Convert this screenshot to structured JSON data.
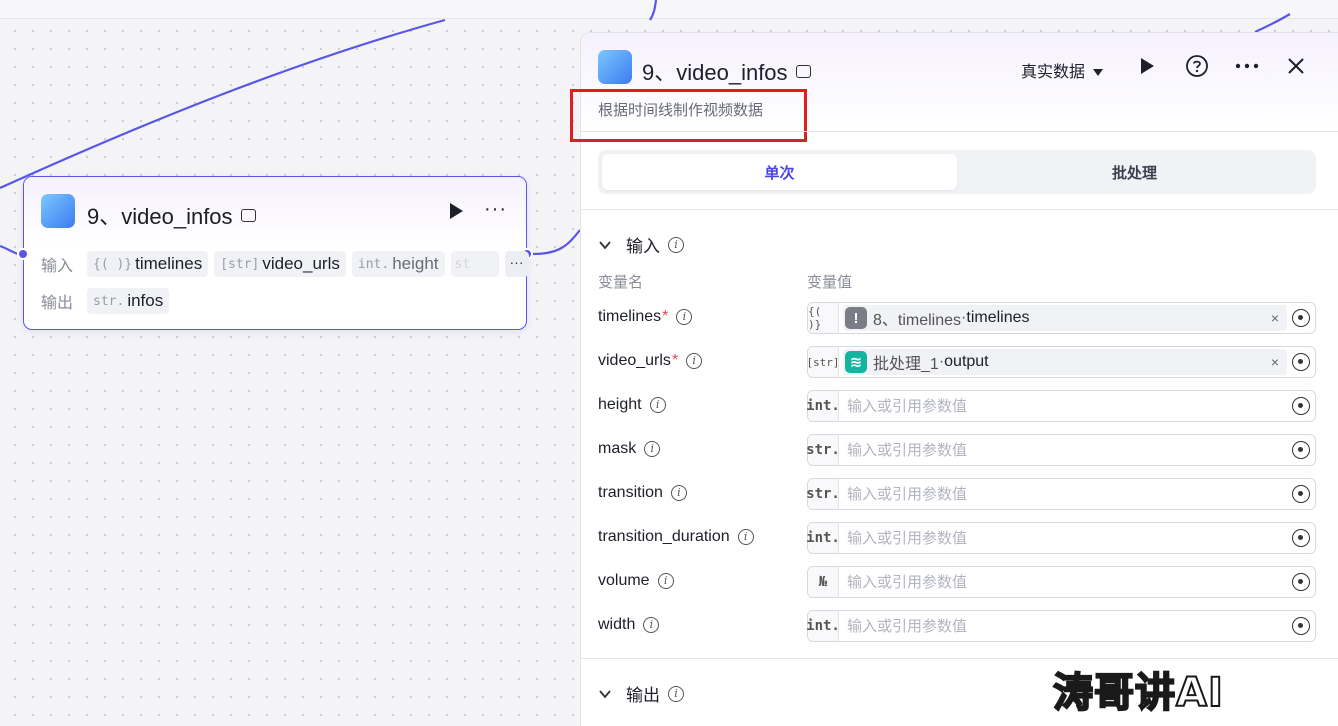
{
  "node": {
    "title": "9、video_infos",
    "input_label": "输入",
    "output_label": "输出",
    "inputs": [
      {
        "type": "{( )}",
        "name": "timelines"
      },
      {
        "type": "[str]",
        "name": "video_urls"
      },
      {
        "type": "int.",
        "name": "height"
      },
      {
        "type": "st",
        "name": ""
      }
    ],
    "more": "···",
    "outputs": [
      {
        "type": "str.",
        "name": "infos"
      }
    ]
  },
  "panel": {
    "title": "9、video_infos",
    "mode": "真实数据",
    "description": "根据时间线制作视频数据",
    "tabs": [
      {
        "label": "单次",
        "active": true
      },
      {
        "label": "批处理",
        "active": false
      }
    ],
    "input_section": "输入",
    "output_section": "输出",
    "col_name": "变量名",
    "col_value": "变量值",
    "placeholder": "输入或引用参数值",
    "params": [
      {
        "name": "timelines",
        "required": true,
        "type": "{( )}",
        "ref": {
          "node": "8、timelines",
          "sep": " · ",
          "field": "timelines",
          "icon_color": "#7a7c86",
          "icon": "!"
        }
      },
      {
        "name": "video_urls",
        "required": true,
        "type": "[str]",
        "ref": {
          "node": "批处理_1",
          "sep": " · ",
          "field": "output",
          "icon_color": "#16b4a0",
          "icon": "≋"
        }
      },
      {
        "name": "height",
        "required": false,
        "type": "int."
      },
      {
        "name": "mask",
        "required": false,
        "type": "str."
      },
      {
        "name": "transition",
        "required": false,
        "type": "str."
      },
      {
        "name": "transition_duration",
        "required": false,
        "type": "int."
      },
      {
        "name": "volume",
        "required": false,
        "type": "№"
      },
      {
        "name": "width",
        "required": false,
        "type": "int."
      }
    ]
  },
  "watermark": "涛哥讲AI",
  "colors": {
    "accent": "#5a56e6",
    "highlight_box": "#e11d1d",
    "tab_active": "#4b44e6"
  }
}
